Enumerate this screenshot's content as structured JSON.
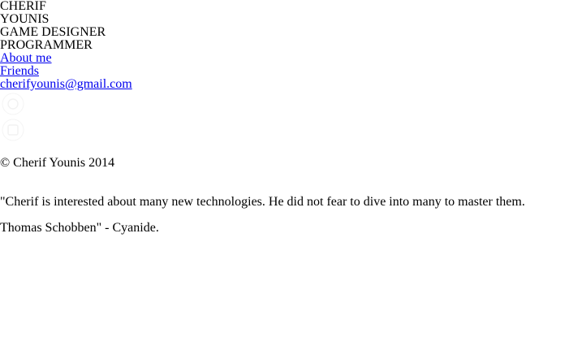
{
  "header": {
    "first_name": "CHERIF",
    "last_name": "YOUNIS",
    "role_1": "GAME DESIGNER",
    "role_2": "PROGRAMMER"
  },
  "nav": {
    "about_label": "About me",
    "friends_label": "Friends",
    "email_label": "cherifyounis@gmail.com"
  },
  "social": {
    "icon_1": "white-social-icon",
    "icon_2": "white-social-icon"
  },
  "footer": {
    "copyright": "© Cherif Younis 2014"
  },
  "testimonial": {
    "quote": "\"Cherif is interested about many new technologies. He did not fear to dive into many to master them.",
    "author": "Thomas Schobben\" - Cyanide."
  },
  "colors": {
    "link": "#0000ee",
    "text": "#000000",
    "background": "#ffffff"
  }
}
